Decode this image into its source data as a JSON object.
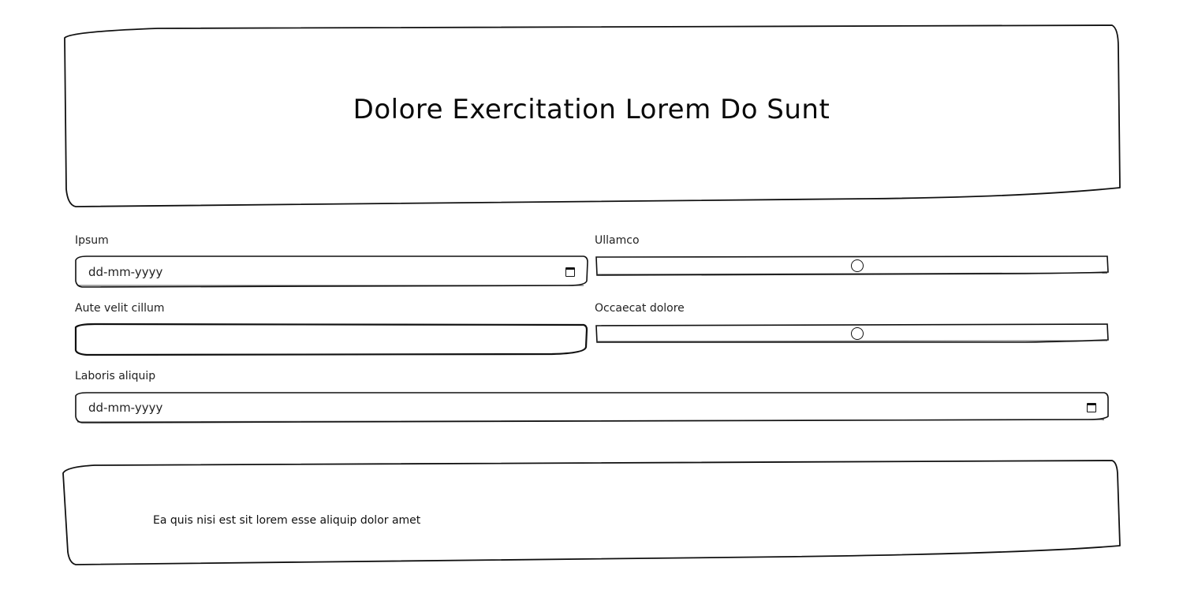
{
  "header": {
    "title": "Dolore Exercitation Lorem Do Sunt"
  },
  "form": {
    "ipsum": {
      "label": "Ipsum",
      "placeholder": "dd-mm-yyyy",
      "icon": "calendar-icon"
    },
    "ullamco": {
      "label": "Ullamco",
      "value_fraction": 0.5
    },
    "aute": {
      "label": "Aute velit cillum",
      "value": ""
    },
    "occaecat": {
      "label": "Occaecat dolore",
      "value_fraction": 0.5
    },
    "laboris": {
      "label": "Laboris aliquip",
      "placeholder": "dd-mm-yyyy",
      "icon": "calendar-icon"
    }
  },
  "footer": {
    "text": "Ea quis nisi est sit lorem esse aliquip dolor amet"
  }
}
